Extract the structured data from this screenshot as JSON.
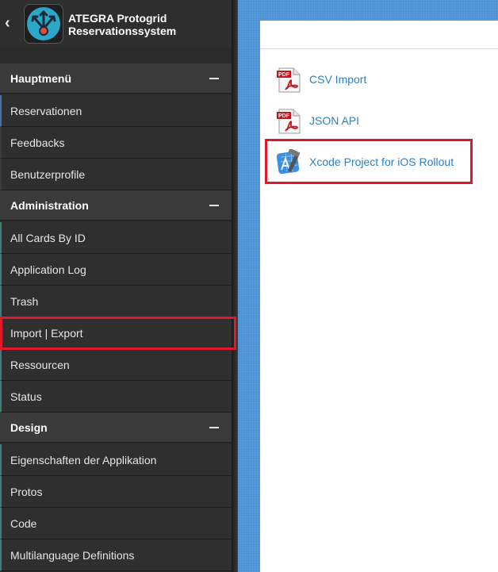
{
  "app": {
    "title_line1": "ATEGRA Protogrid",
    "title_line2": "Reservationssystem"
  },
  "sidebar": {
    "sections": [
      {
        "label": "Hauptmenü",
        "items": [
          "Reservationen",
          "Feedbacks",
          "Benutzerprofile"
        ]
      },
      {
        "label": "Administration",
        "items": [
          "All Cards By ID",
          "Application Log",
          "Trash",
          "Import | Export",
          "Ressourcen",
          "Status"
        ]
      },
      {
        "label": "Design",
        "items": [
          "Eigenschaften der Applikation",
          "Protos",
          "Code",
          "Multilanguage Definitions"
        ]
      }
    ]
  },
  "main": {
    "links": [
      {
        "label": "CSV Import",
        "icon": "pdf-icon"
      },
      {
        "label": "JSON API",
        "icon": "pdf-icon"
      },
      {
        "label": "Xcode Project for iOS Rollout",
        "icon": "xcode-icon"
      }
    ]
  },
  "colors": {
    "highlight": "#e0182d",
    "link": "#2e7fc1",
    "background": "#4b91d6"
  }
}
